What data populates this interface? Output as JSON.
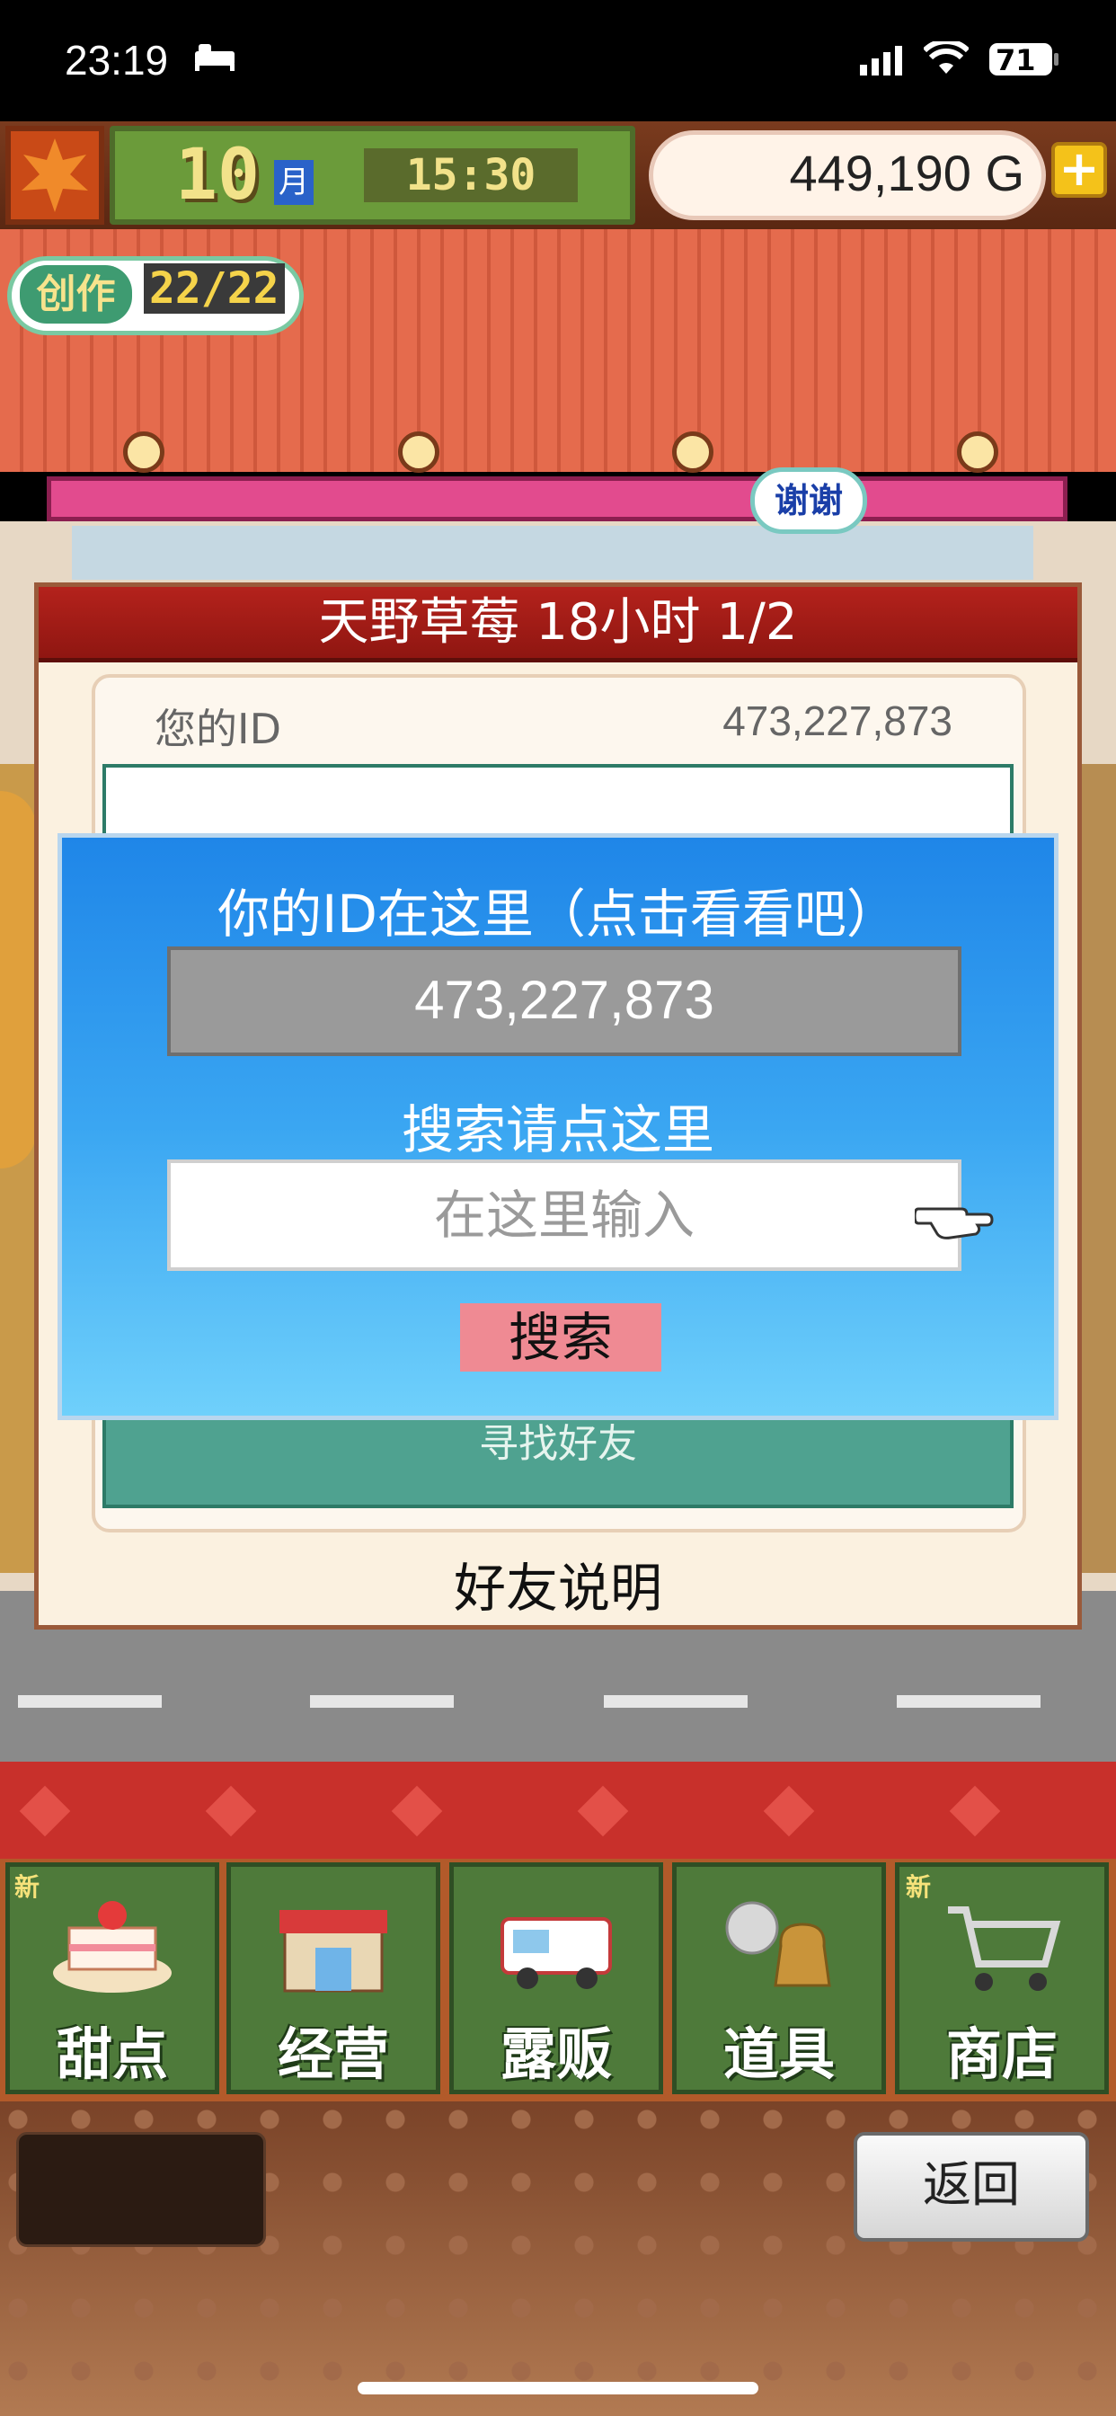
{
  "status_bar": {
    "time": "23:19",
    "battery": "71"
  },
  "hud": {
    "month": "10",
    "month_unit": "月",
    "clock": "15:30",
    "gold": "449,190 G",
    "plus": "+"
  },
  "create": {
    "label": "创作",
    "count": "22/22"
  },
  "speech": {
    "thanks": "谢谢"
  },
  "panel": {
    "title": "天野草莓  18小时 1/2",
    "id_label": "您的ID",
    "id_value": "473,227,873",
    "find_friend": "寻找好友",
    "help": "好友说明"
  },
  "dialog": {
    "title": "你的ID在这里（点击看看吧）",
    "my_id": "473,227,873",
    "search_hint": "搜索请点这里",
    "search_placeholder": "在这里输入",
    "search_button": "搜索"
  },
  "menu": {
    "items": [
      {
        "label": "甜点",
        "new": "新",
        "icon": "cake-icon"
      },
      {
        "label": "经营",
        "new": "",
        "icon": "shop-icon"
      },
      {
        "label": "露贩",
        "new": "",
        "icon": "food-truck-icon"
      },
      {
        "label": "道具",
        "new": "",
        "icon": "item-bag-icon"
      },
      {
        "label": "商店",
        "new": "新",
        "icon": "cart-icon"
      }
    ],
    "back": "返回"
  }
}
